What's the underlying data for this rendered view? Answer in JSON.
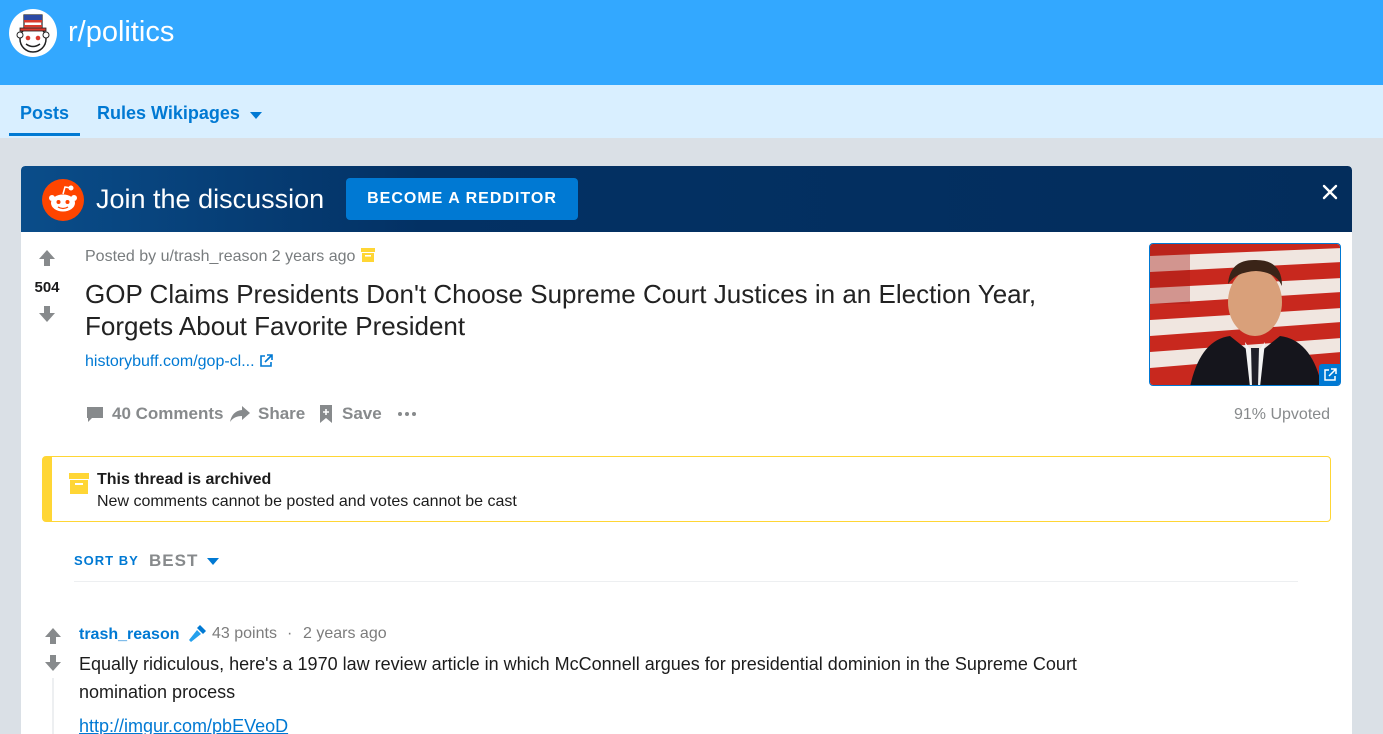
{
  "header": {
    "subreddit": "r/politics"
  },
  "nav": {
    "tabs": [
      {
        "label": "Posts",
        "active": true
      },
      {
        "label": "Rules Wikipages",
        "active": false
      }
    ]
  },
  "banner": {
    "text": "Join the discussion",
    "button_label": "BECOME A REDDITOR"
  },
  "post": {
    "score": "504",
    "posted_by": "Posted by u/trash_reason 2 years ago",
    "title": "GOP Claims Presidents Don't Choose Supreme Court Justices in an Election Year, Forgets About Favorite President",
    "link": "historybuff.com/gop-cl...",
    "actions": {
      "comments": "40 Comments",
      "share": "Share",
      "save": "Save",
      "more": "···"
    },
    "upvoted": "91% Upvoted"
  },
  "archived": {
    "title": "This thread is archived",
    "subtitle": "New comments cannot be posted and votes cannot be cast"
  },
  "sort": {
    "label": "SORT BY",
    "value": "BEST"
  },
  "comment": {
    "author": "trash_reason",
    "points": "43 points",
    "separator": "·",
    "time": "2 years ago",
    "body": "Equally ridiculous, here's a 1970 law review article in which McConnell argues for presidential dominion in the Supreme Court nomination process",
    "link": "http://imgur.com/pbEVeoD"
  },
  "colors": {
    "header_bg": "#33a8ff",
    "nav_bg": "#d9efff",
    "accent": "#0079d3",
    "banner_bg": "#032d5c",
    "archive_yellow": "#ffd635"
  },
  "icons": [
    "subreddit-logo-icon",
    "caret-down-icon",
    "reddit-snoo-icon",
    "close-icon",
    "upvote-arrow-icon",
    "downvote-arrow-icon",
    "archive-box-icon",
    "external-link-icon",
    "comment-bubble-icon",
    "share-arrow-icon",
    "save-bookmark-icon",
    "more-dots-icon",
    "microphone-icon"
  ]
}
